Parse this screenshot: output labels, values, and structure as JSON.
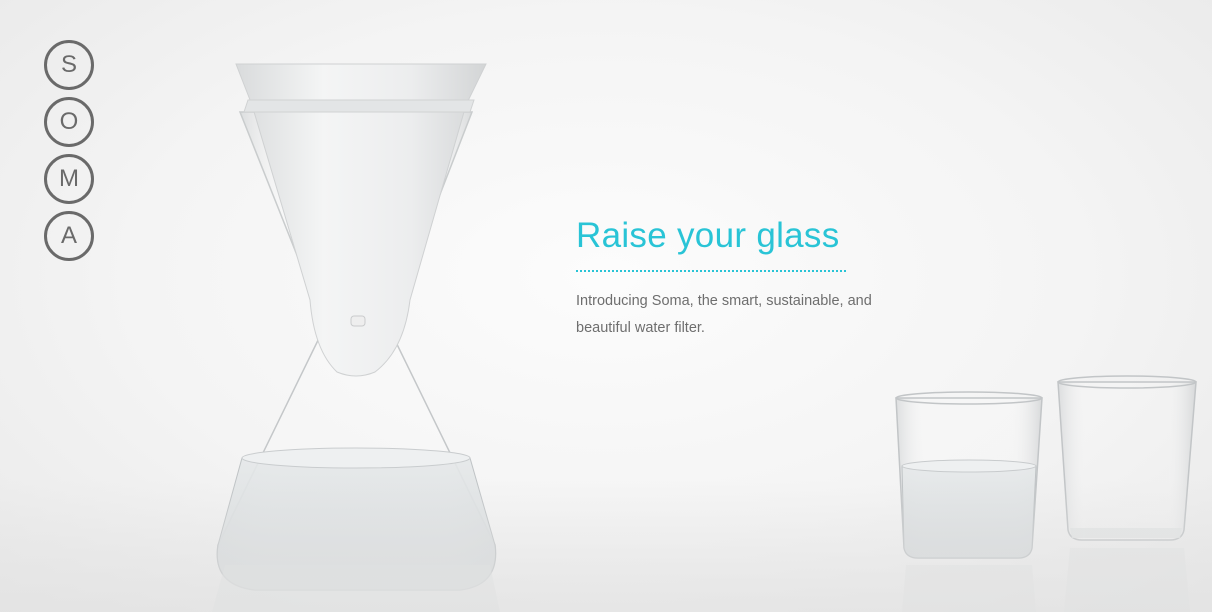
{
  "brand": {
    "name": "SOMA",
    "letters": [
      "S",
      "O",
      "M",
      "A"
    ]
  },
  "hero": {
    "headline": "Raise your glass",
    "intro": "Introducing Soma, the smart, sustainable, and beautiful water filter."
  },
  "colors": {
    "accent": "#29c4d6",
    "logo": "#6a6a6a",
    "body_text": "#6e6e6e",
    "background": "#f4f4f4"
  }
}
